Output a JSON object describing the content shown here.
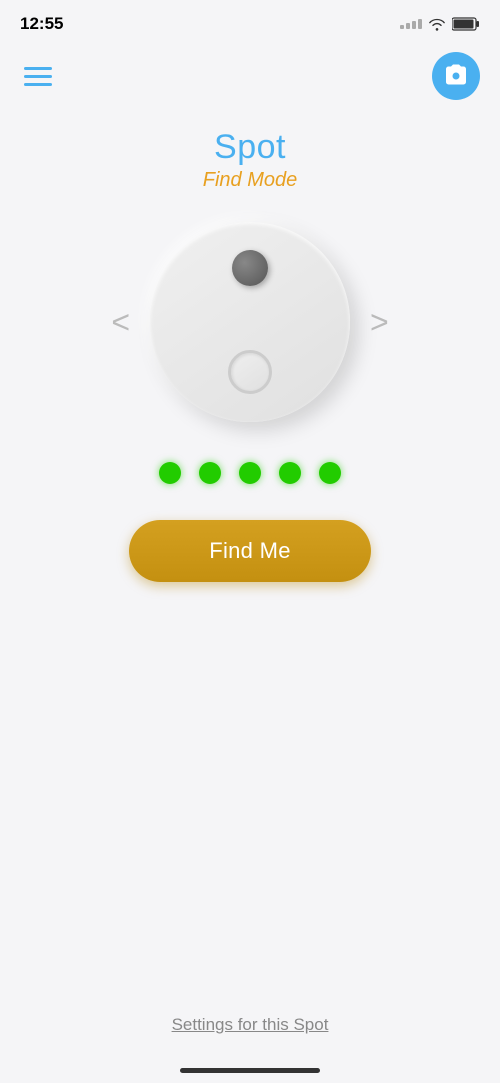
{
  "statusBar": {
    "time": "12:55"
  },
  "nav": {
    "menuLabel": "Menu",
    "cameraLabel": "Camera"
  },
  "title": "Spot",
  "subtitle": "Find Mode",
  "leftArrow": "<",
  "rightArrow": ">",
  "signalDots": [
    1,
    2,
    3,
    4,
    5
  ],
  "findMeButton": "Find Me",
  "settingsLink": "Settings for this Spot"
}
